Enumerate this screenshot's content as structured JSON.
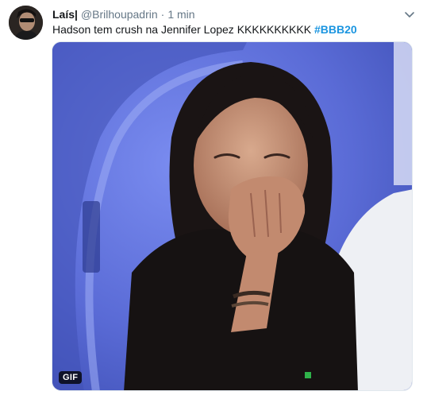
{
  "tweet": {
    "author_name": "Laís|",
    "handle": "@Brilhoupadrin",
    "separator": "·",
    "time": "1 min",
    "text": "Hadson tem crush na Jennifer Lopez KKKKKKKKKK ",
    "hashtag": "#BBB20",
    "media": {
      "badge": "GIF",
      "icon": "animated-gif-image"
    },
    "menu_icon": "chevron-down-icon"
  },
  "colors": {
    "hashtag": "#1b95e0",
    "secondary_text": "#657786",
    "primary_text": "#14171a",
    "border": "#e1e8ed"
  }
}
